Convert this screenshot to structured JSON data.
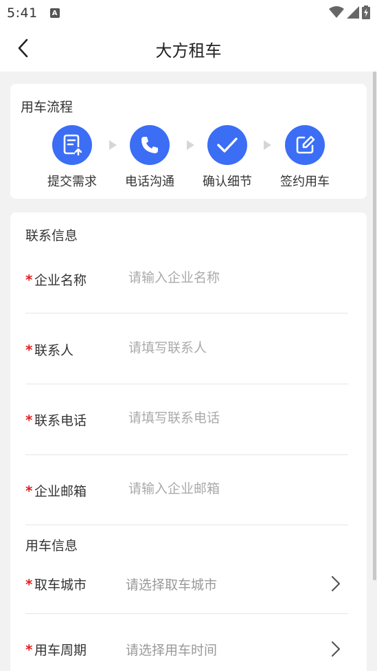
{
  "status_bar": {
    "time": "5:41",
    "badge": "A"
  },
  "header": {
    "title": "大方租车"
  },
  "process": {
    "title": "用车流程",
    "steps": [
      {
        "label": "提交需求",
        "icon": "document-upload-icon"
      },
      {
        "label": "电话沟通",
        "icon": "phone-icon"
      },
      {
        "label": "确认细节",
        "icon": "check-icon"
      },
      {
        "label": "签约用车",
        "icon": "edit-icon"
      }
    ]
  },
  "contact": {
    "title": "联系信息",
    "fields": [
      {
        "label": "企业名称",
        "placeholder": "请输入企业名称",
        "required": true
      },
      {
        "label": "联系人",
        "placeholder": "请填写联系人",
        "required": true
      },
      {
        "label": "联系电话",
        "placeholder": "请填写联系电话",
        "required": true
      },
      {
        "label": "企业邮箱",
        "placeholder": "请输入企业邮箱",
        "required": true
      }
    ]
  },
  "usage": {
    "title": "用车信息",
    "fields": [
      {
        "label": "取车城市",
        "placeholder": "请选择取车城市",
        "required": true
      },
      {
        "label": "用车周期",
        "placeholder": "请选择用车时间",
        "required": true
      }
    ]
  },
  "colors": {
    "accent": "#3b6ef5",
    "required": "#e02020",
    "background": "#f2f2f2"
  }
}
